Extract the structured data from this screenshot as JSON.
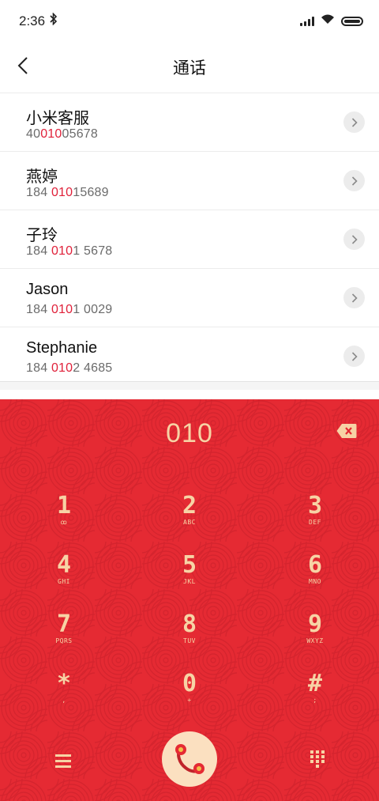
{
  "status_bar": {
    "time": "2:36",
    "bluetooth_icon": "bluetooth-icon",
    "signal_icon": "signal-icon",
    "wifi_icon": "wifi-icon",
    "battery_icon": "battery-icon"
  },
  "header": {
    "title": "通话",
    "back_icon": "back-chevron-icon"
  },
  "contacts": [
    {
      "name": "小米客服",
      "number_pre": "40",
      "number_hl": "010",
      "number_post": "05678"
    },
    {
      "name": "燕婷",
      "number_pre": "184 ",
      "number_hl": "010",
      "number_post": "15689"
    },
    {
      "name": "子玲",
      "number_pre": "184 ",
      "number_hl": "010",
      "number_post": "1 5678"
    },
    {
      "name": "Jason",
      "number_pre": "184 ",
      "number_hl": "010",
      "number_post": "1 0029"
    },
    {
      "name": "Stephanie",
      "number_pre": "184 ",
      "number_hl": "010",
      "number_post": "2 4685"
    }
  ],
  "dialpad": {
    "input": "010",
    "keys": [
      {
        "digit": "1",
        "sub": "ꝏ"
      },
      {
        "digit": "2",
        "sub": "ABC"
      },
      {
        "digit": "3",
        "sub": "DEF"
      },
      {
        "digit": "4",
        "sub": "GHI"
      },
      {
        "digit": "5",
        "sub": "JKL"
      },
      {
        "digit": "6",
        "sub": "MNO"
      },
      {
        "digit": "7",
        "sub": "PQRS"
      },
      {
        "digit": "8",
        "sub": "TUV"
      },
      {
        "digit": "9",
        "sub": "WXYZ"
      },
      {
        "digit": "*",
        "sub": ","
      },
      {
        "digit": "0",
        "sub": "+"
      },
      {
        "digit": "#",
        "sub": ";"
      }
    ]
  },
  "colors": {
    "accent": "#e0213a",
    "dial_bg": "#e52a33",
    "dial_text": "#f7d3a5"
  }
}
